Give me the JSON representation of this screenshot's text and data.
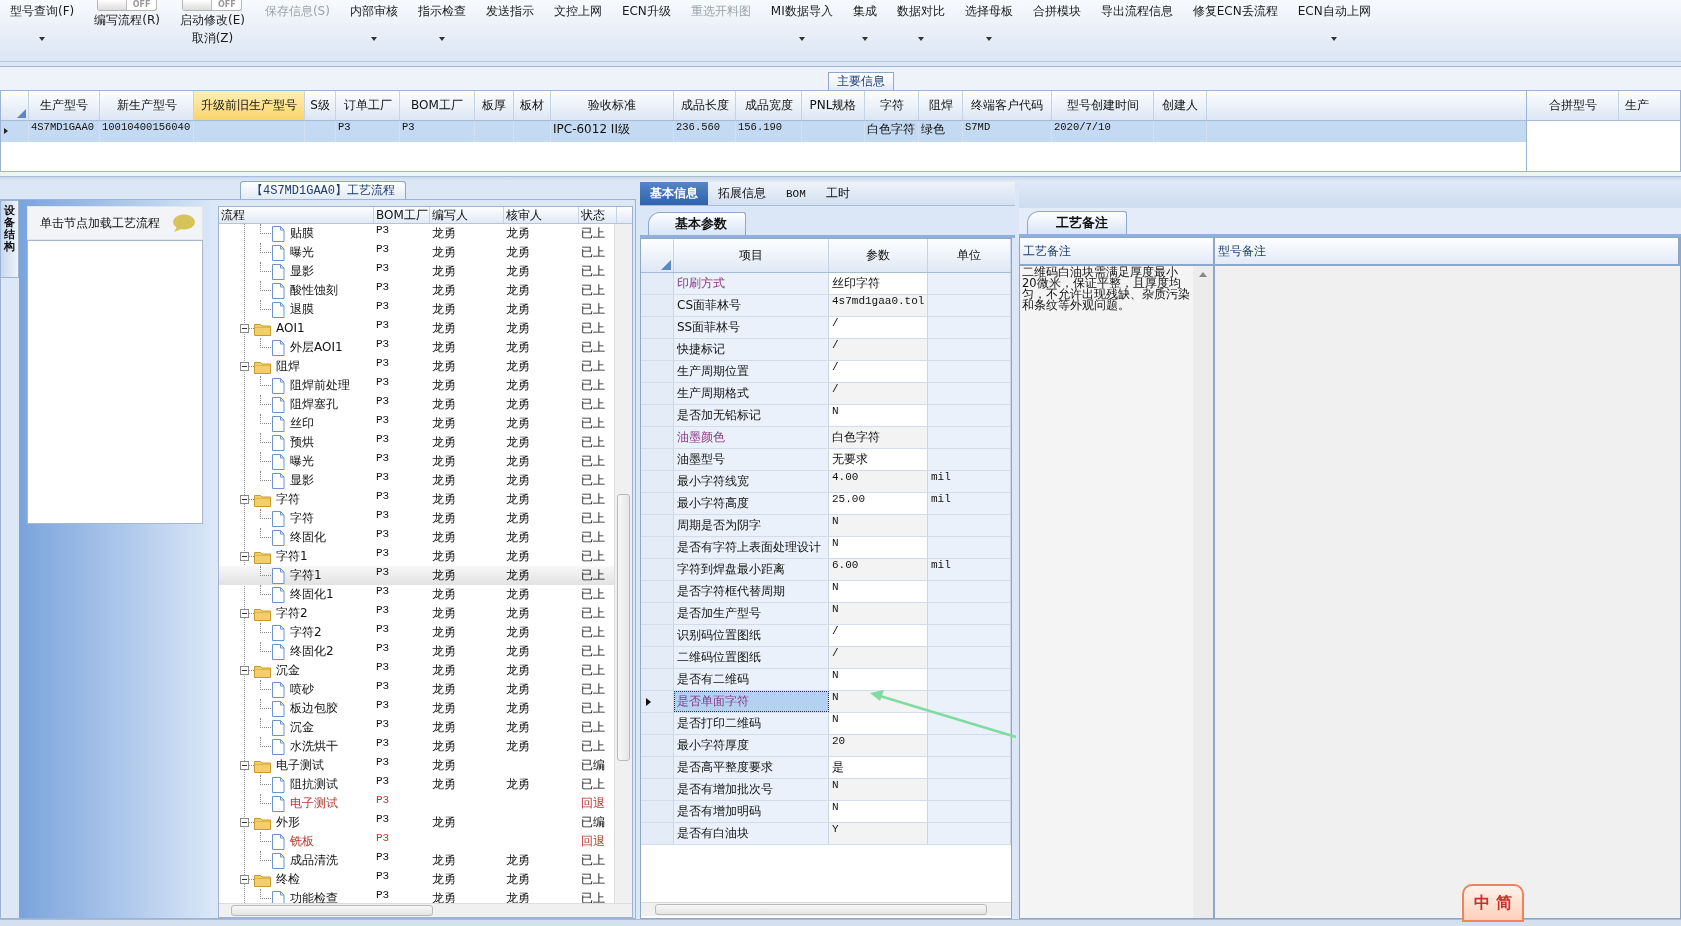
{
  "toolbar": [
    {
      "kind": "button",
      "label": "型号查询(F)",
      "dropdown": true,
      "disabled": false
    },
    {
      "kind": "toggle",
      "switch": "OFF",
      "on": false,
      "labels": [
        "编写流程(R)"
      ]
    },
    {
      "kind": "toggle",
      "switch": "OFF",
      "on": false,
      "labels": [
        "启动修改(E)",
        "取消(Z)"
      ]
    },
    {
      "kind": "button",
      "label": "保存信息(S)",
      "dropdown": false,
      "disabled": true
    },
    {
      "kind": "button",
      "label": "内部审核",
      "dropdown": true,
      "disabled": false
    },
    {
      "kind": "button",
      "label": "指示检查",
      "dropdown": true,
      "disabled": false
    },
    {
      "kind": "button",
      "label": "发送指示",
      "dropdown": false,
      "disabled": false
    },
    {
      "kind": "button",
      "label": "文控上网",
      "dropdown": false,
      "disabled": false
    },
    {
      "kind": "button",
      "label": "ECN升级",
      "dropdown": false,
      "disabled": false
    },
    {
      "kind": "button",
      "label": "重选开料图",
      "dropdown": false,
      "disabled": true
    },
    {
      "kind": "button",
      "label": "MI数据导入",
      "dropdown": true,
      "disabled": false
    },
    {
      "kind": "button",
      "label": "集成",
      "dropdown": true,
      "disabled": false
    },
    {
      "kind": "button",
      "label": "数据对比",
      "dropdown": true,
      "disabled": false
    },
    {
      "kind": "button",
      "label": "选择母板",
      "dropdown": true,
      "disabled": false
    },
    {
      "kind": "button",
      "label": "合拼模块",
      "dropdown": false,
      "disabled": false
    },
    {
      "kind": "button",
      "label": "导出流程信息",
      "dropdown": false,
      "disabled": false
    },
    {
      "kind": "button",
      "label": "修复ECN丢流程",
      "dropdown": false,
      "disabled": false
    },
    {
      "kind": "button",
      "label": "ECN自动上网",
      "dropdown": true,
      "disabled": false
    }
  ],
  "main_info": {
    "title": "主要信息",
    "columns": [
      {
        "label": "生产型号",
        "highlighted": false
      },
      {
        "label": "新生产型号",
        "highlighted": false
      },
      {
        "label": "升级前旧生产型号",
        "highlighted": true
      },
      {
        "label": "S级",
        "highlighted": false
      },
      {
        "label": "订单工厂",
        "highlighted": false
      },
      {
        "label": "BOM工厂",
        "highlighted": false
      },
      {
        "label": "板厚",
        "highlighted": false
      },
      {
        "label": "板材",
        "highlighted": false
      },
      {
        "label": "验收标准",
        "highlighted": false
      },
      {
        "label": "成品长度",
        "highlighted": false
      },
      {
        "label": "成品宽度",
        "highlighted": false
      },
      {
        "label": "PNL规格",
        "highlighted": false
      },
      {
        "label": "字符",
        "highlighted": false
      },
      {
        "label": "阻焊",
        "highlighted": false
      },
      {
        "label": "终端客户代码",
        "highlighted": false
      },
      {
        "label": "型号创建时间",
        "highlighted": false
      },
      {
        "label": "创建人",
        "highlighted": false
      }
    ],
    "rows": [
      {
        "selected": true,
        "cells": [
          "4S7MD1GAA0",
          "10010400156040",
          null,
          null,
          "P3",
          "P3",
          null,
          null,
          "IPC-6012 II级",
          "236.560",
          "156.190",
          null,
          "白色字符",
          "绿色",
          "S7MD",
          "2020/7/10",
          null
        ]
      }
    ],
    "side_columns": [
      "合拼型号",
      "生产"
    ]
  },
  "process_flow": {
    "tab": "【4S7MD1GAA0】工艺流程",
    "side_tab": "设备结构",
    "hint": "单击节点加载工艺流程",
    "columns": [
      "流程",
      "BOM工厂",
      "编写人",
      "核审人",
      "状态"
    ],
    "nodes": [
      {
        "children": [
          {
            "label": "贴膜",
            "bom": "P3",
            "author": "龙勇",
            "reviewer": "龙勇",
            "status": "已上",
            "returned": false,
            "selected": false
          },
          {
            "label": "曝光",
            "bom": "P3",
            "author": "龙勇",
            "reviewer": "龙勇",
            "status": "已上",
            "returned": false,
            "selected": false
          },
          {
            "label": "显影",
            "bom": "P3",
            "author": "龙勇",
            "reviewer": "龙勇",
            "status": "已上",
            "returned": false,
            "selected": false
          },
          {
            "label": "酸性蚀刻",
            "bom": "P3",
            "author": "龙勇",
            "reviewer": "龙勇",
            "status": "已上",
            "returned": false,
            "selected": false
          },
          {
            "label": "退膜",
            "bom": "P3",
            "author": "龙勇",
            "reviewer": "龙勇",
            "status": "已上",
            "returned": false,
            "selected": false
          }
        ]
      },
      {
        "label": "AOI1",
        "bom": "P3",
        "author": "龙勇",
        "reviewer": "龙勇",
        "status": "已上",
        "returned": false,
        "selected": false,
        "expanded": true,
        "children": [
          {
            "label": "外层AOI1",
            "bom": "P3",
            "author": "龙勇",
            "reviewer": "龙勇",
            "status": "已上",
            "returned": false,
            "selected": false
          }
        ]
      },
      {
        "label": "阻焊",
        "bom": "P3",
        "author": "龙勇",
        "reviewer": "龙勇",
        "status": "已上",
        "returned": false,
        "selected": false,
        "expanded": true,
        "children": [
          {
            "label": "阻焊前处理",
            "bom": "P3",
            "author": "龙勇",
            "reviewer": "龙勇",
            "status": "已上",
            "returned": false,
            "selected": false
          },
          {
            "label": "阻焊塞孔",
            "bom": "P3",
            "author": "龙勇",
            "reviewer": "龙勇",
            "status": "已上",
            "returned": false,
            "selected": false
          },
          {
            "label": "丝印",
            "bom": "P3",
            "author": "龙勇",
            "reviewer": "龙勇",
            "status": "已上",
            "returned": false,
            "selected": false
          },
          {
            "label": "预烘",
            "bom": "P3",
            "author": "龙勇",
            "reviewer": "龙勇",
            "status": "已上",
            "returned": false,
            "selected": false
          },
          {
            "label": "曝光",
            "bom": "P3",
            "author": "龙勇",
            "reviewer": "龙勇",
            "status": "已上",
            "returned": false,
            "selected": false
          },
          {
            "label": "显影",
            "bom": "P3",
            "author": "龙勇",
            "reviewer": "龙勇",
            "status": "已上",
            "returned": false,
            "selected": false
          }
        ]
      },
      {
        "label": "字符",
        "bom": "P3",
        "author": "龙勇",
        "reviewer": "龙勇",
        "status": "已上",
        "returned": false,
        "selected": false,
        "expanded": true,
        "children": [
          {
            "label": "字符",
            "bom": "P3",
            "author": "龙勇",
            "reviewer": "龙勇",
            "status": "已上",
            "returned": false,
            "selected": false
          },
          {
            "label": "终固化",
            "bom": "P3",
            "author": "龙勇",
            "reviewer": "龙勇",
            "status": "已上",
            "returned": false,
            "selected": false
          }
        ]
      },
      {
        "label": "字符1",
        "bom": "P3",
        "author": "龙勇",
        "reviewer": "龙勇",
        "status": "已上",
        "returned": false,
        "selected": false,
        "expanded": true,
        "children": [
          {
            "label": "字符1",
            "bom": "P3",
            "author": "龙勇",
            "reviewer": "龙勇",
            "status": "已上",
            "returned": false,
            "selected": true
          },
          {
            "label": "终固化1",
            "bom": "P3",
            "author": "龙勇",
            "reviewer": "龙勇",
            "status": "已上",
            "returned": false,
            "selected": false
          }
        ]
      },
      {
        "label": "字符2",
        "bom": "P3",
        "author": "龙勇",
        "reviewer": "龙勇",
        "status": "已上",
        "returned": false,
        "selected": false,
        "expanded": true,
        "children": [
          {
            "label": "字符2",
            "bom": "P3",
            "author": "龙勇",
            "reviewer": "龙勇",
            "status": "已上",
            "returned": false,
            "selected": false
          },
          {
            "label": "终固化2",
            "bom": "P3",
            "author": "龙勇",
            "reviewer": "龙勇",
            "status": "已上",
            "returned": false,
            "selected": false
          }
        ]
      },
      {
        "label": "沉金",
        "bom": "P3",
        "author": "龙勇",
        "reviewer": "龙勇",
        "status": "已上",
        "returned": false,
        "selected": false,
        "expanded": true,
        "children": [
          {
            "label": "喷砂",
            "bom": "P3",
            "author": "龙勇",
            "reviewer": "龙勇",
            "status": "已上",
            "returned": false,
            "selected": false
          },
          {
            "label": "板边包胶",
            "bom": "P3",
            "author": "龙勇",
            "reviewer": "龙勇",
            "status": "已上",
            "returned": false,
            "selected": false
          },
          {
            "label": "沉金",
            "bom": "P3",
            "author": "龙勇",
            "reviewer": "龙勇",
            "status": "已上",
            "returned": false,
            "selected": false
          },
          {
            "label": "水洗烘干",
            "bom": "P3",
            "author": "龙勇",
            "reviewer": "龙勇",
            "status": "已上",
            "returned": false,
            "selected": false
          }
        ]
      },
      {
        "label": "电子测试",
        "bom": "P3",
        "author": "龙勇",
        "status": "已编",
        "returned": false,
        "selected": false,
        "expanded": true,
        "children": [
          {
            "label": "阻抗测试",
            "bom": "P3",
            "author": "龙勇",
            "reviewer": "龙勇",
            "status": "已上",
            "returned": false,
            "selected": false
          },
          {
            "label": "电子测试",
            "bom": "P3",
            "status": "回退",
            "returned": true,
            "selected": false
          }
        ]
      },
      {
        "label": "外形",
        "bom": "P3",
        "author": "龙勇",
        "status": "已编",
        "returned": false,
        "selected": false,
        "expanded": true,
        "children": [
          {
            "label": "铣板",
            "bom": "P3",
            "status": "回退",
            "returned": true,
            "selected": false
          },
          {
            "label": "成品清洗",
            "bom": "P3",
            "author": "龙勇",
            "reviewer": "龙勇",
            "status": "已上",
            "returned": false,
            "selected": false
          }
        ]
      },
      {
        "label": "终检",
        "bom": "P3",
        "author": "龙勇",
        "reviewer": "龙勇",
        "status": "已上",
        "returned": false,
        "selected": false,
        "expanded": true,
        "children": [
          {
            "label": "功能检查",
            "bom": "P3",
            "author": "龙勇",
            "reviewer": "龙勇",
            "status": "已上",
            "returned": false,
            "selected": false
          }
        ]
      }
    ]
  },
  "details": {
    "tabs": [
      {
        "label": "基本信息",
        "selected": true
      },
      {
        "label": "拓展信息",
        "selected": false
      },
      {
        "label": "BOM",
        "selected": false
      },
      {
        "label": "工时",
        "selected": false
      }
    ],
    "subtab": "基本参数",
    "columns": [
      "项目",
      "参数",
      "单位"
    ],
    "rows": [
      {
        "item": "印刷方式",
        "value": "丝印字符",
        "highlighted": true,
        "selected": false
      },
      {
        "item": "CS面菲林号",
        "value": "4s7md1gaa0.tol",
        "highlighted": false,
        "selected": false
      },
      {
        "item": "SS面菲林号",
        "value": "/",
        "highlighted": false,
        "selected": false
      },
      {
        "item": "快捷标记",
        "value": "/",
        "highlighted": false,
        "selected": false
      },
      {
        "item": "生产周期位置",
        "value": "/",
        "highlighted": false,
        "selected": false
      },
      {
        "item": "生产周期格式",
        "value": "/",
        "highlighted": false,
        "selected": false
      },
      {
        "item": "是否加无铅标记",
        "value": "N",
        "highlighted": false,
        "selected": false
      },
      {
        "item": "油墨颜色",
        "value": "白色字符",
        "highlighted": true,
        "selected": false
      },
      {
        "item": "油墨型号",
        "value": "无要求",
        "highlighted": false,
        "selected": false
      },
      {
        "item": "最小字符线宽",
        "value": "4.00",
        "unit": "mil",
        "highlighted": false,
        "selected": false
      },
      {
        "item": "最小字符高度",
        "value": "25.00",
        "unit": "mil",
        "highlighted": false,
        "selected": false
      },
      {
        "item": "周期是否为阴字",
        "value": "N",
        "highlighted": false,
        "selected": false
      },
      {
        "item": "是否有字符上表面处理设计",
        "value": "N",
        "highlighted": false,
        "selected": false
      },
      {
        "item": "字符到焊盘最小距离",
        "value": "6.00",
        "unit": "mil",
        "highlighted": false,
        "selected": false
      },
      {
        "item": "是否字符框代替周期",
        "value": "N",
        "highlighted": false,
        "selected": false
      },
      {
        "item": "是否加生产型号",
        "value": "N",
        "highlighted": false,
        "selected": false
      },
      {
        "item": "识别码位置图纸",
        "value": "/",
        "highlighted": false,
        "selected": false
      },
      {
        "item": "二维码位置图纸",
        "value": "/",
        "highlighted": false,
        "selected": false
      },
      {
        "item": "是否有二维码",
        "value": "N",
        "highlighted": false,
        "selected": false
      },
      {
        "item": "是否单面字符",
        "value": "N",
        "highlighted": true,
        "selected": true
      },
      {
        "item": "是否打印二维码",
        "value": "N",
        "highlighted": false,
        "selected": false
      },
      {
        "item": "最小字符厚度",
        "value": "20",
        "highlighted": false,
        "selected": false
      },
      {
        "item": "是否高平整度要求",
        "value": "是",
        "highlighted": false,
        "selected": false
      },
      {
        "item": "是否有增加批次号",
        "value": "N",
        "highlighted": false,
        "selected": false
      },
      {
        "item": "是否有增加明码",
        "value": "N",
        "highlighted": false,
        "selected": false
      },
      {
        "item": "是否有白油块",
        "value": "Y",
        "highlighted": false,
        "selected": false
      }
    ]
  },
  "notes": {
    "tab": "工艺备注",
    "columns": [
      "工艺备注",
      "型号备注"
    ],
    "process_note": "二维码白油块需满足厚度最小20微米，保证平整，且厚度均匀，不允许出现残缺、杂质污染和条纹等外观问题。"
  },
  "ime": {
    "labels": [
      "中",
      "简"
    ]
  }
}
